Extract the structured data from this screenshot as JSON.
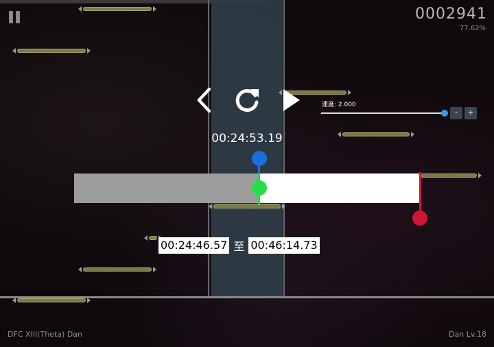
{
  "hud": {
    "score": "0002941",
    "accuracy": "77.62%",
    "pause_icon": "pause-icon"
  },
  "controls": {
    "back_icon": "chevron-left-icon",
    "restart_icon": "restart-icon",
    "play_icon": "play-icon"
  },
  "speed": {
    "label": "速度: 2.000",
    "value": 2.0,
    "minus_label": "-",
    "plus_label": "+",
    "knob_color": "#3d9be9"
  },
  "seek": {
    "current_time": "00:24:53.19",
    "range_start": "00:24:46.57",
    "range_separator": "至",
    "range_end": "00:46:14.73",
    "played_fraction": 0.535,
    "end_marker_fraction": 1.0,
    "colors": {
      "current_marker": "#1a6fe0",
      "start_marker": "#22e04a",
      "end_marker": "#d01538",
      "played": "#9d9d9d",
      "remaining": "#ffffff"
    }
  },
  "song": {
    "title": "DFC XIII(Theta) Dan",
    "level": "Dan Lv.18"
  },
  "colors": {
    "note_body": "#7d7a48",
    "lane_center": "#2f3d47",
    "background": "#0e090c"
  }
}
